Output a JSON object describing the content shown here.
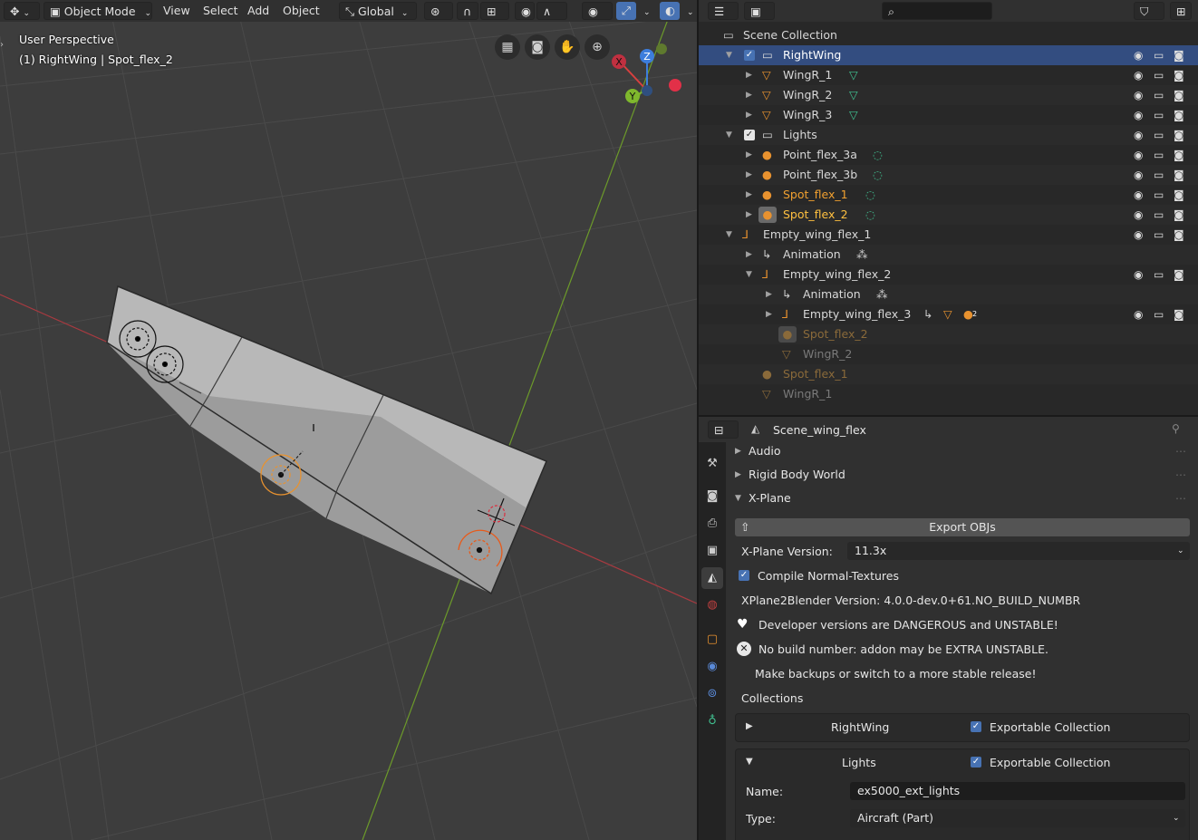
{
  "viewport": {
    "menu": {
      "mode": "Object Mode",
      "view": "View",
      "select": "Select",
      "add": "Add",
      "object": "Object",
      "orientation": "Global"
    },
    "overlay": {
      "perspective": "User Perspective",
      "active": "(1) RightWing | Spot_flex_2"
    },
    "gizmo": {
      "x": "X",
      "y": "Y",
      "z": "Z"
    },
    "colors": {
      "x_axis": "#d8403f",
      "y_axis": "#7fb82d",
      "z_axis": "#3d7ddc",
      "light": "#e8922f"
    }
  },
  "outliner": {
    "header": {
      "search_placeholder": ""
    },
    "root": "Scene Collection",
    "rows": [
      {
        "label": "RightWing",
        "type": "collection",
        "color": "#e0e0e0"
      },
      {
        "label": "WingR_1",
        "type": "mesh",
        "color": "#e0e0e0"
      },
      {
        "label": "WingR_2",
        "type": "mesh",
        "color": "#e0e0e0"
      },
      {
        "label": "WingR_3",
        "type": "mesh",
        "color": "#e0e0e0"
      },
      {
        "label": "Lights",
        "type": "collection",
        "color": "#e0e0e0"
      },
      {
        "label": "Point_flex_3a",
        "type": "light",
        "color": "#e0e0e0"
      },
      {
        "label": "Point_flex_3b",
        "type": "light",
        "color": "#e0e0e0"
      },
      {
        "label": "Spot_flex_1",
        "type": "light",
        "color": "#f0a030"
      },
      {
        "label": "Spot_flex_2",
        "type": "light",
        "color": "#ffc040"
      },
      {
        "label": "Empty_wing_flex_1",
        "type": "empty",
        "color": "#e0e0e0"
      },
      {
        "label": "Animation",
        "type": "anim",
        "color": "#e0e0e0"
      },
      {
        "label": "Empty_wing_flex_2",
        "type": "empty",
        "color": "#e0e0e0"
      },
      {
        "label": "Animation",
        "type": "anim",
        "color": "#e0e0e0"
      },
      {
        "label": "Empty_wing_flex_3",
        "type": "empty",
        "color": "#e0e0e0"
      },
      {
        "label": "Spot_flex_2",
        "type": "light-ghost",
        "color": "#8a6a3a"
      },
      {
        "label": "WingR_2",
        "type": "mesh-ghost",
        "color": "#7a7a7a"
      },
      {
        "label": "Spot_flex_1",
        "type": "light-ghost",
        "color": "#8a6a3a"
      },
      {
        "label": "WingR_1",
        "type": "mesh-ghost",
        "color": "#7a7a7a"
      }
    ],
    "badge": "2"
  },
  "properties": {
    "scene_name": "Scene_wing_flex",
    "panels": {
      "audio": "Audio",
      "rigid": "Rigid Body World",
      "xplane": "X-Plane"
    },
    "export_button": "Export OBJs",
    "version_label": "X-Plane Version:",
    "version_value": "11.3x",
    "compile_label": "Compile Normal-Textures",
    "addon_version": "XPlane2Blender Version: 4.0.0-dev.0+61.NO_BUILD_NUMBR",
    "warning_dev": "Developer versions are DANGEROUS and UNSTABLE!",
    "warning_build": "No build number: addon may be EXTRA UNSTABLE.",
    "warning_backup": "Make backups or switch to a more stable release!",
    "collections_label": "Collections",
    "collections": [
      {
        "name": "RightWing",
        "exportable": "Exportable Collection"
      },
      {
        "name": "Lights",
        "exportable": "Exportable Collection"
      }
    ],
    "name_label": "Name:",
    "name_value": "ex5000_ext_lights",
    "type_label": "Type:",
    "type_value": "Aircraft (Part)"
  }
}
